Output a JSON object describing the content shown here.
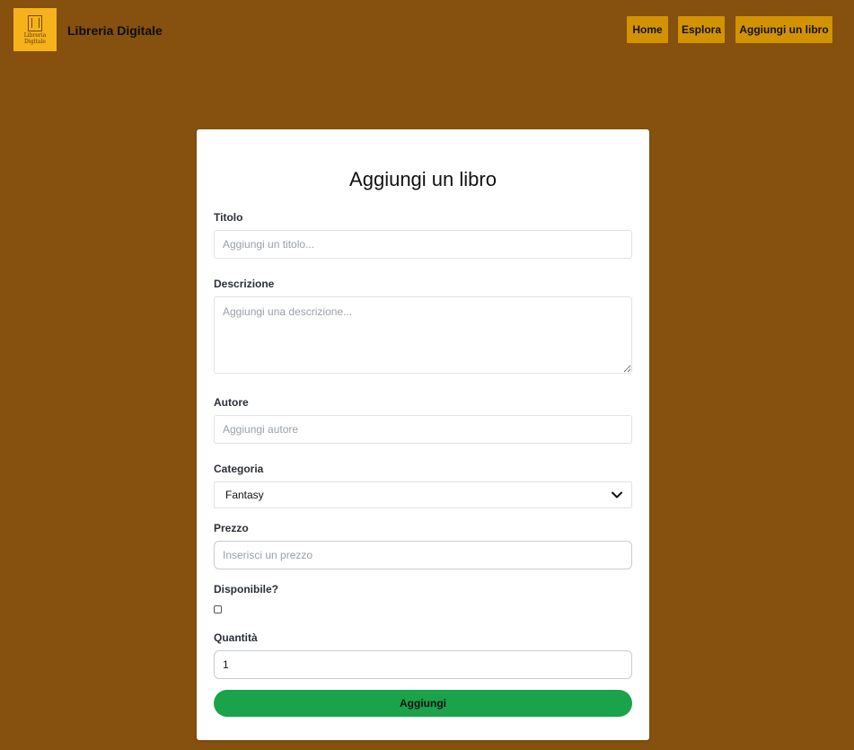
{
  "header": {
    "logo_text": "Libreria\nDigitale",
    "brand_name": "Libreria Digitale",
    "nav": [
      {
        "label": "Home"
      },
      {
        "label": "Esplora"
      },
      {
        "label": "Aggiungi un libro"
      }
    ]
  },
  "form": {
    "title": "Aggiungi un libro",
    "titolo": {
      "label": "Titolo",
      "placeholder": "Aggiungi un titolo...",
      "value": ""
    },
    "descrizione": {
      "label": "Descrizione",
      "placeholder": "Aggiungi una descrizione...",
      "value": ""
    },
    "autore": {
      "label": "Autore",
      "placeholder": "Aggiungi autore",
      "value": ""
    },
    "categoria": {
      "label": "Categoria",
      "selected": "Fantasy"
    },
    "prezzo": {
      "label": "Prezzo",
      "placeholder": "Inserisci un prezzo",
      "value": ""
    },
    "disponibile": {
      "label": "Disponibile?",
      "checked": false
    },
    "quantita": {
      "label": "Quantità",
      "value": "1"
    },
    "submit_label": "Aggiungi"
  },
  "colors": {
    "background": "#86500e",
    "logo_bg": "#f6b21b",
    "nav_button": "#d39300",
    "submit_button": "#1aa34a"
  },
  "icons": {
    "logo": "book-logo-icon",
    "select_arrow": "chevron-down-icon"
  }
}
